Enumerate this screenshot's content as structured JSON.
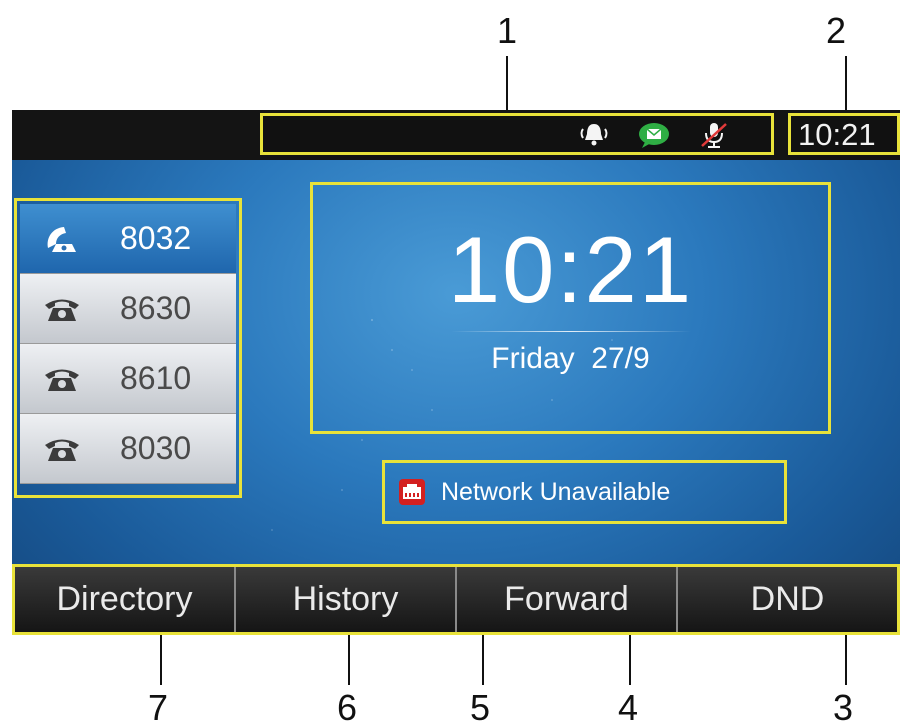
{
  "callouts": [
    "1",
    "2",
    "3",
    "4",
    "5",
    "6",
    "7"
  ],
  "status_bar": {
    "icons": [
      "ringing-bell-icon",
      "message-icon",
      "mute-microphone-icon"
    ],
    "time": "10:21"
  },
  "line_keys": [
    {
      "number": "8032",
      "state": "active",
      "icon": "handset-icon"
    },
    {
      "number": "8630",
      "state": "idle",
      "icon": "phone-icon"
    },
    {
      "number": "8610",
      "state": "idle",
      "icon": "phone-icon"
    },
    {
      "number": "8030",
      "state": "idle",
      "icon": "phone-icon"
    }
  ],
  "clock": {
    "time": "10:21",
    "date": "Friday  27/9"
  },
  "network": {
    "icon": "network-port-icon",
    "message": "Network Unavailable"
  },
  "softkeys": [
    "Directory",
    "History",
    "Forward",
    "DND"
  ],
  "colors": {
    "highlight_frame": "#e8e23a",
    "screen_blue": "#2b79bd",
    "message_green": "#2fae44",
    "network_red": "#d32020"
  }
}
